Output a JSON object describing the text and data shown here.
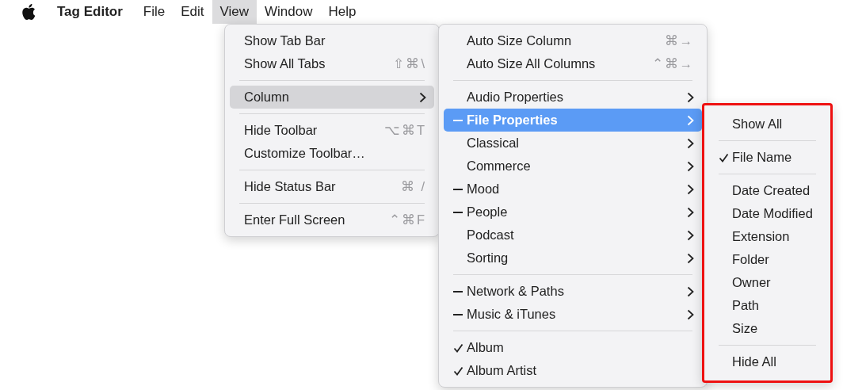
{
  "menu_bar": {
    "app_name": "Tag Editor",
    "items": [
      {
        "label": "File",
        "selected": false
      },
      {
        "label": "Edit",
        "selected": false
      },
      {
        "label": "View",
        "selected": true
      },
      {
        "label": "Window",
        "selected": false
      },
      {
        "label": "Help",
        "selected": false
      }
    ]
  },
  "menus": [
    {
      "highlighted": false,
      "items": [
        {
          "kind": "item",
          "label": "Show Tab Bar",
          "submenu": false,
          "selected": false
        },
        {
          "kind": "item",
          "label": "Show All Tabs",
          "shortcut": "⇧⌘\\",
          "submenu": false,
          "selected": false
        },
        {
          "kind": "separator"
        },
        {
          "kind": "item",
          "label": "Column",
          "submenu": true,
          "selected": true
        },
        {
          "kind": "separator"
        },
        {
          "kind": "item",
          "label": "Hide Toolbar",
          "shortcut": "⌥⌘T",
          "submenu": false,
          "selected": false
        },
        {
          "kind": "item",
          "label": "Customize Toolbar…",
          "submenu": false,
          "selected": false
        },
        {
          "kind": "separator"
        },
        {
          "kind": "item",
          "label": "Hide Status Bar",
          "shortcut": "⌘ /",
          "submenu": false,
          "selected": false
        },
        {
          "kind": "separator"
        },
        {
          "kind": "item",
          "label": "Enter Full Screen",
          "shortcut": "⌃⌘F",
          "submenu": false,
          "selected": false
        }
      ]
    },
    {
      "highlighted": false,
      "items": [
        {
          "kind": "item",
          "label": "Auto Size Column",
          "shortcut": "⌘→",
          "checked": false,
          "mixed": false,
          "submenu": false,
          "selected": false
        },
        {
          "kind": "item",
          "label": "Auto Size All Columns",
          "shortcut": "⌃⌘→",
          "checked": false,
          "mixed": false,
          "submenu": false,
          "selected": false
        },
        {
          "kind": "separator"
        },
        {
          "kind": "item",
          "label": "Audio Properties",
          "checked": false,
          "mixed": false,
          "submenu": true,
          "selected": false
        },
        {
          "kind": "item",
          "label": "File Properties",
          "checked": false,
          "mixed": true,
          "submenu": true,
          "selected": true
        },
        {
          "kind": "item",
          "label": "Classical",
          "checked": false,
          "mixed": false,
          "submenu": true,
          "selected": false
        },
        {
          "kind": "item",
          "label": "Commerce",
          "checked": false,
          "mixed": false,
          "submenu": true,
          "selected": false
        },
        {
          "kind": "item",
          "label": "Mood",
          "checked": false,
          "mixed": true,
          "submenu": true,
          "selected": false
        },
        {
          "kind": "item",
          "label": "People",
          "checked": false,
          "mixed": true,
          "submenu": true,
          "selected": false
        },
        {
          "kind": "item",
          "label": "Podcast",
          "checked": false,
          "mixed": false,
          "submenu": true,
          "selected": false
        },
        {
          "kind": "item",
          "label": "Sorting",
          "checked": false,
          "mixed": false,
          "submenu": true,
          "selected": false
        },
        {
          "kind": "separator"
        },
        {
          "kind": "item",
          "label": "Network & Paths",
          "checked": false,
          "mixed": true,
          "submenu": true,
          "selected": false
        },
        {
          "kind": "item",
          "label": "Music & iTunes",
          "checked": false,
          "mixed": true,
          "submenu": true,
          "selected": false
        },
        {
          "kind": "separator"
        },
        {
          "kind": "item",
          "label": "Album",
          "checked": true,
          "mixed": false,
          "submenu": false,
          "selected": false
        },
        {
          "kind": "item",
          "label": "Album Artist",
          "checked": true,
          "mixed": false,
          "submenu": false,
          "selected": false
        }
      ]
    },
    {
      "highlighted": true,
      "items": [
        {
          "kind": "item",
          "label": "Show All",
          "checked": false,
          "mixed": false,
          "submenu": false,
          "selected": false
        },
        {
          "kind": "separator"
        },
        {
          "kind": "item",
          "label": "File Name",
          "checked": true,
          "mixed": false,
          "submenu": false,
          "selected": false
        },
        {
          "kind": "separator"
        },
        {
          "kind": "item",
          "label": "Date Created",
          "checked": false,
          "mixed": false,
          "submenu": false,
          "selected": false
        },
        {
          "kind": "item",
          "label": "Date Modified",
          "checked": false,
          "mixed": false,
          "submenu": false,
          "selected": false
        },
        {
          "kind": "item",
          "label": "Extension",
          "checked": false,
          "mixed": false,
          "submenu": false,
          "selected": false
        },
        {
          "kind": "item",
          "label": "Folder",
          "checked": false,
          "mixed": false,
          "submenu": false,
          "selected": false
        },
        {
          "kind": "item",
          "label": "Owner",
          "checked": false,
          "mixed": false,
          "submenu": false,
          "selected": false
        },
        {
          "kind": "item",
          "label": "Path",
          "checked": false,
          "mixed": false,
          "submenu": false,
          "selected": false
        },
        {
          "kind": "item",
          "label": "Size",
          "checked": false,
          "mixed": false,
          "submenu": false,
          "selected": false
        },
        {
          "kind": "separator"
        },
        {
          "kind": "item",
          "label": "Hide All",
          "checked": false,
          "mixed": false,
          "submenu": false,
          "selected": false
        }
      ]
    }
  ]
}
